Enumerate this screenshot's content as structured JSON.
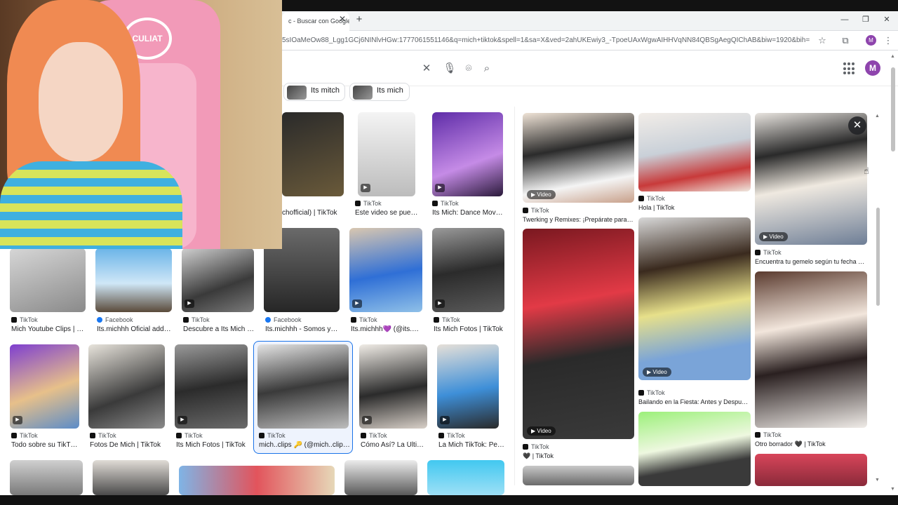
{
  "browser": {
    "tab_title": "c - Buscar con Google",
    "url": "5sIOaMeOw88_Lgg1GCj6NINlvHGw:1777061551146&q=mich+tiktok&spell=1&sa=X&ved=2ahUKEwiy3_-TpoeUAxWgwAIHHVqNN84QBSgAegQIChAB&biw=1920&bih=945&dpr=1...",
    "profile_initial": "M"
  },
  "google": {
    "profile_initial": "M",
    "chips": [
      "Its mitch",
      "Its mich"
    ]
  },
  "icons": {
    "clear": "close-icon",
    "voice": "microphone-icon",
    "lens": "camera-icon",
    "search": "search-icon"
  },
  "results": [
    {
      "source": "",
      "title": "chofficial) | TikTok",
      "video": false
    },
    {
      "source": "TikTok",
      "title": "Este video se pued…",
      "video": true
    },
    {
      "source": "TikTok",
      "title": "Its Mich: Dance Mov…",
      "video": true
    },
    {
      "source": "TikTok",
      "title": "Mich Youtube Clips | …",
      "video": false
    },
    {
      "source": "Facebook",
      "title": "Its.michhh Oficial add…",
      "video": false
    },
    {
      "source": "TikTok",
      "title": "Descubre a Its Mich …",
      "video": true
    },
    {
      "source": "Facebook",
      "title": "Its.michhh - Somos y…",
      "video": false
    },
    {
      "source": "TikTok",
      "title": "Its.michhh💜 (@its.…",
      "video": true
    },
    {
      "source": "TikTok",
      "title": "Its Mich Fotos | TikTok",
      "video": true
    },
    {
      "source": "TikTok",
      "title": "Todo sobre su TikT…",
      "video": true
    },
    {
      "source": "TikTok",
      "title": "Fotos De Mich | TikTok",
      "video": false
    },
    {
      "source": "TikTok",
      "title": "Its Mich Fotos | TikTok",
      "video": true
    },
    {
      "source": "TikTok",
      "title": "mich..clips 🔑 (@mich..clip…",
      "video": false
    },
    {
      "source": "TikTok",
      "title": "Cómo Así? La Últi…",
      "video": true
    },
    {
      "source": "TikTok",
      "title": "La Mich TikTok: Pe…",
      "video": true
    }
  ],
  "panel": {
    "video_label": "Video",
    "items": [
      {
        "source": "TikTok",
        "title": "Twerking y Remixes: ¡Prepárate para el…"
      },
      {
        "source": "TikTok",
        "title": "Hola | TikTok"
      },
      {
        "source": "TikTok",
        "title": "Encuentra tu gemelo según tu fecha de…"
      },
      {
        "source": "TikTok",
        "title": "Bailando en la Fiesta: Antes y Después…"
      },
      {
        "source": "TikTok",
        "title": "🖤 | TikTok"
      },
      {
        "source": "TikTok",
        "title": "Otro borrador 🖤 | TikTok"
      }
    ]
  },
  "webcam": {
    "chair_logo": "CULIAT"
  },
  "colors": {
    "accent": "#1a73e8",
    "profile": "#8e44ad"
  }
}
